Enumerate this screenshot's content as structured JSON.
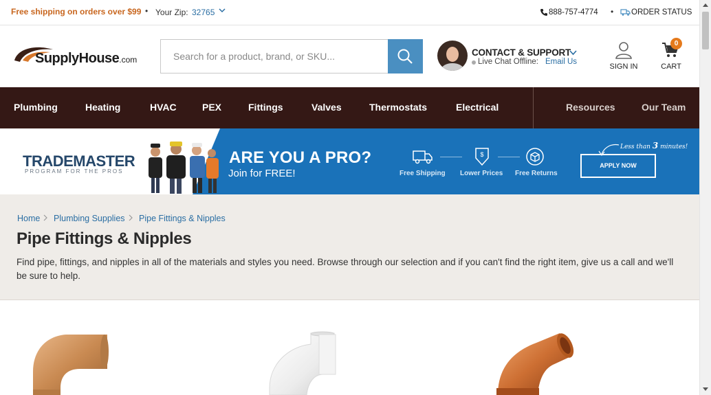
{
  "topbar": {
    "shipping": "Free shipping on orders over $99",
    "separator": "•",
    "zip_label": "Your Zip:",
    "zip_value": "32765",
    "phone": "888-757-4774",
    "order_status": "ORDER STATUS"
  },
  "header": {
    "logo_brand": "SupplyHouse",
    "logo_suffix": ".com",
    "search_placeholder": "Search for a product, brand, or SKU...",
    "contact_title": "CONTACT & SUPPORT",
    "chat_status": "Live Chat Offline:",
    "email_link": "Email Us",
    "sign_in": "SIGN IN",
    "cart_label": "CART",
    "cart_count": "0"
  },
  "nav": {
    "items": [
      "Plumbing",
      "Heating",
      "HVAC",
      "PEX",
      "Fittings",
      "Valves",
      "Thermostats",
      "Electrical"
    ],
    "secondary": [
      "Resources",
      "Our Team"
    ]
  },
  "banner": {
    "program_title": "TRADEMASTER",
    "program_sub": "PROGRAM FOR THE PROS",
    "headline": "ARE YOU A PRO?",
    "subline": "Join for FREE!",
    "perks": [
      "Free Shipping",
      "Lower Prices",
      "Free Returns"
    ],
    "apply": "APPLY NOW",
    "note_prefix": "Less than",
    "note_num": "3",
    "note_suffix": "minutes!"
  },
  "category": {
    "breadcrumbs": [
      "Home",
      "Plumbing Supplies",
      "Pipe Fittings & Nipples"
    ],
    "title": "Pipe Fittings & Nipples",
    "description": "Find pipe, fittings, and nipples in all of the materials and styles you need. Browse through our selection and if you can't find the right item, give us a call and we'll be sure to help."
  },
  "colors": {
    "nav_bg": "#341815",
    "accent_orange": "#c8661e",
    "link_blue": "#2a6ea3",
    "banner_blue": "#1a72b9",
    "search_button": "#4a8fc1"
  },
  "icons": {
    "zip": "chevron-down-icon",
    "phone": "phone-icon",
    "order": "truck-icon",
    "search": "search-icon",
    "user": "user-icon",
    "cart": "cart-icon"
  }
}
